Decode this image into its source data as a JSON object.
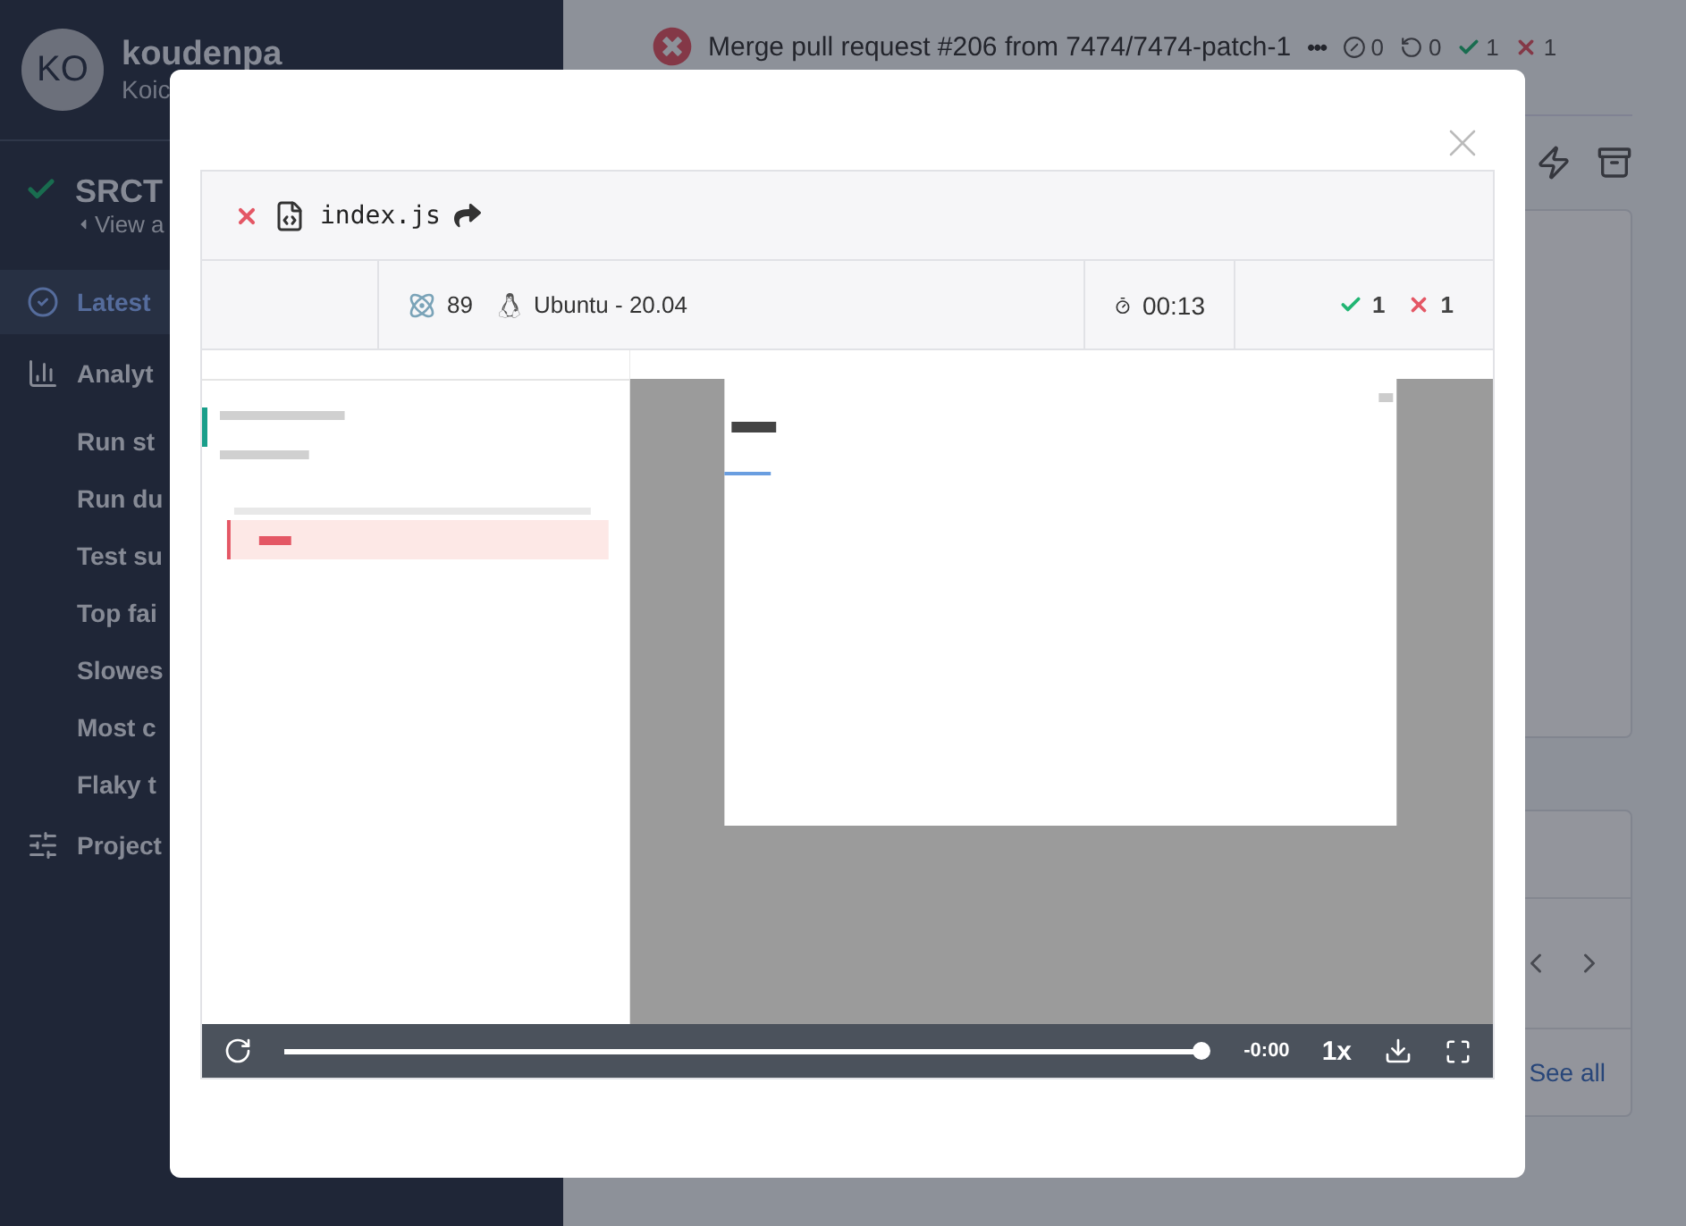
{
  "sidebar": {
    "user": {
      "avatar": "KO",
      "name": "koudenpa",
      "subtitle": "Koic"
    },
    "project": {
      "passed": true,
      "name": "SRCT",
      "back_link": "View a"
    },
    "nav": [
      {
        "kind": "latest",
        "label": "Latest",
        "selected": true
      },
      {
        "kind": "analytics",
        "label": "Analyt",
        "selected": false
      },
      {
        "kind": "sub",
        "label": "Run st",
        "selected": false
      },
      {
        "kind": "sub",
        "label": "Run du",
        "selected": false
      },
      {
        "kind": "sub",
        "label": "Test su",
        "selected": false
      },
      {
        "kind": "sub",
        "label": "Top fai",
        "selected": false
      },
      {
        "kind": "sub",
        "label": "Slowes",
        "selected": false
      },
      {
        "kind": "sub",
        "label": "Most c",
        "selected": false
      },
      {
        "kind": "sub",
        "label": "Flaky t",
        "selected": false
      },
      {
        "kind": "settings",
        "label": "Project",
        "selected": false
      }
    ]
  },
  "run": {
    "passed": false,
    "title": "Merge pull request #206 from 7474/7474-patch-1",
    "menu": "•••",
    "counts": [
      {
        "kind": "skipped",
        "value": "0"
      },
      {
        "kind": "pending",
        "value": "0"
      },
      {
        "kind": "passed",
        "value": "1"
      },
      {
        "kind": "failed",
        "value": "1"
      }
    ],
    "see_all": "See all"
  },
  "modal": {
    "spec": {
      "passed": false,
      "file": "index.js"
    },
    "browser_version": "89",
    "os": "Ubuntu - 20.04",
    "duration": "00:13",
    "results": [
      {
        "kind": "passed",
        "value": "1"
      },
      {
        "kind": "failed",
        "value": "1"
      }
    ],
    "video": {
      "kind": "picture",
      "progress": {
        "level": 1
      },
      "time": "-0:00",
      "speed": "1x"
    }
  }
}
